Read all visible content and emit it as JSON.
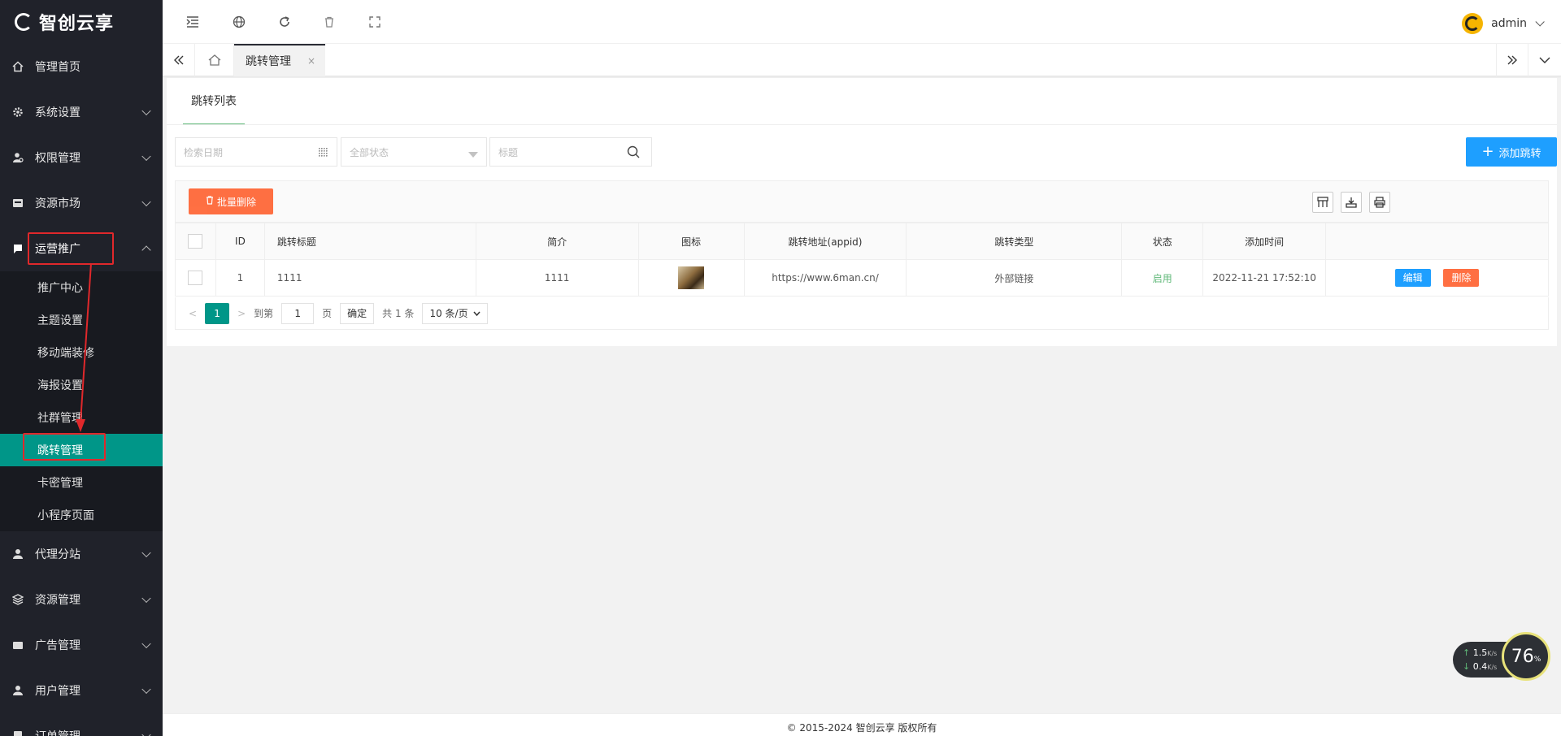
{
  "app": {
    "logo_text": "智创云享"
  },
  "sidebar": {
    "items": [
      {
        "label": "管理首页",
        "icon": "home-icon"
      },
      {
        "label": "系统设置",
        "icon": "gear-icon"
      },
      {
        "label": "权限管理",
        "icon": "users-icon"
      },
      {
        "label": "资源市场",
        "icon": "store-icon"
      },
      {
        "label": "运营推广",
        "icon": "flag-icon"
      },
      {
        "label": "代理分站",
        "icon": "agent-icon"
      },
      {
        "label": "资源管理",
        "icon": "layers-icon"
      },
      {
        "label": "广告管理",
        "icon": "ad-icon"
      },
      {
        "label": "用户管理",
        "icon": "user-icon"
      },
      {
        "label": "订单管理",
        "icon": "order-icon"
      }
    ],
    "sub_items": [
      "推广中心",
      "主题设置",
      "移动端装修",
      "海报设置",
      "社群管理",
      "跳转管理",
      "卡密管理",
      "小程序页面"
    ],
    "active_sub": "跳转管理"
  },
  "header": {
    "username": "admin"
  },
  "tabs": {
    "active": "跳转管理",
    "close": "×"
  },
  "card": {
    "tab_label": "跳转列表",
    "filters": {
      "date_placeholder": "检索日期",
      "status_placeholder": "全部状态",
      "title_placeholder": "标题"
    },
    "add_button": "添加跳转",
    "batch_delete": "批量删除"
  },
  "table": {
    "headers": [
      "ID",
      "跳转标题",
      "简介",
      "图标",
      "跳转地址(appid)",
      "跳转类型",
      "状态",
      "添加时间"
    ],
    "rows": [
      {
        "id": "1",
        "title": "1111",
        "intro": "1111",
        "url": "https://www.6man.cn/",
        "type": "外部链接",
        "status": "启用",
        "time": "2022-11-21 17:52:10",
        "edit": "编辑",
        "delete": "删除"
      }
    ]
  },
  "pager": {
    "current": "1",
    "goto_prefix": "到第",
    "goto_value": "1",
    "goto_suffix": "页",
    "confirm": "确定",
    "total": "共 1 条",
    "per_page": "10 条/页"
  },
  "footer": {
    "copyright": "© 2015-2024 智创云享 版权所有"
  },
  "net_widget": {
    "up": "1.5",
    "down": "0.4",
    "unit": "K/s",
    "percent": "76",
    "pct_sign": "%"
  },
  "colors": {
    "sidebar": "#20222a",
    "active": "#009688",
    "primary": "#1e9fff",
    "danger": "#ff5722",
    "highlight": "#e0282b"
  }
}
